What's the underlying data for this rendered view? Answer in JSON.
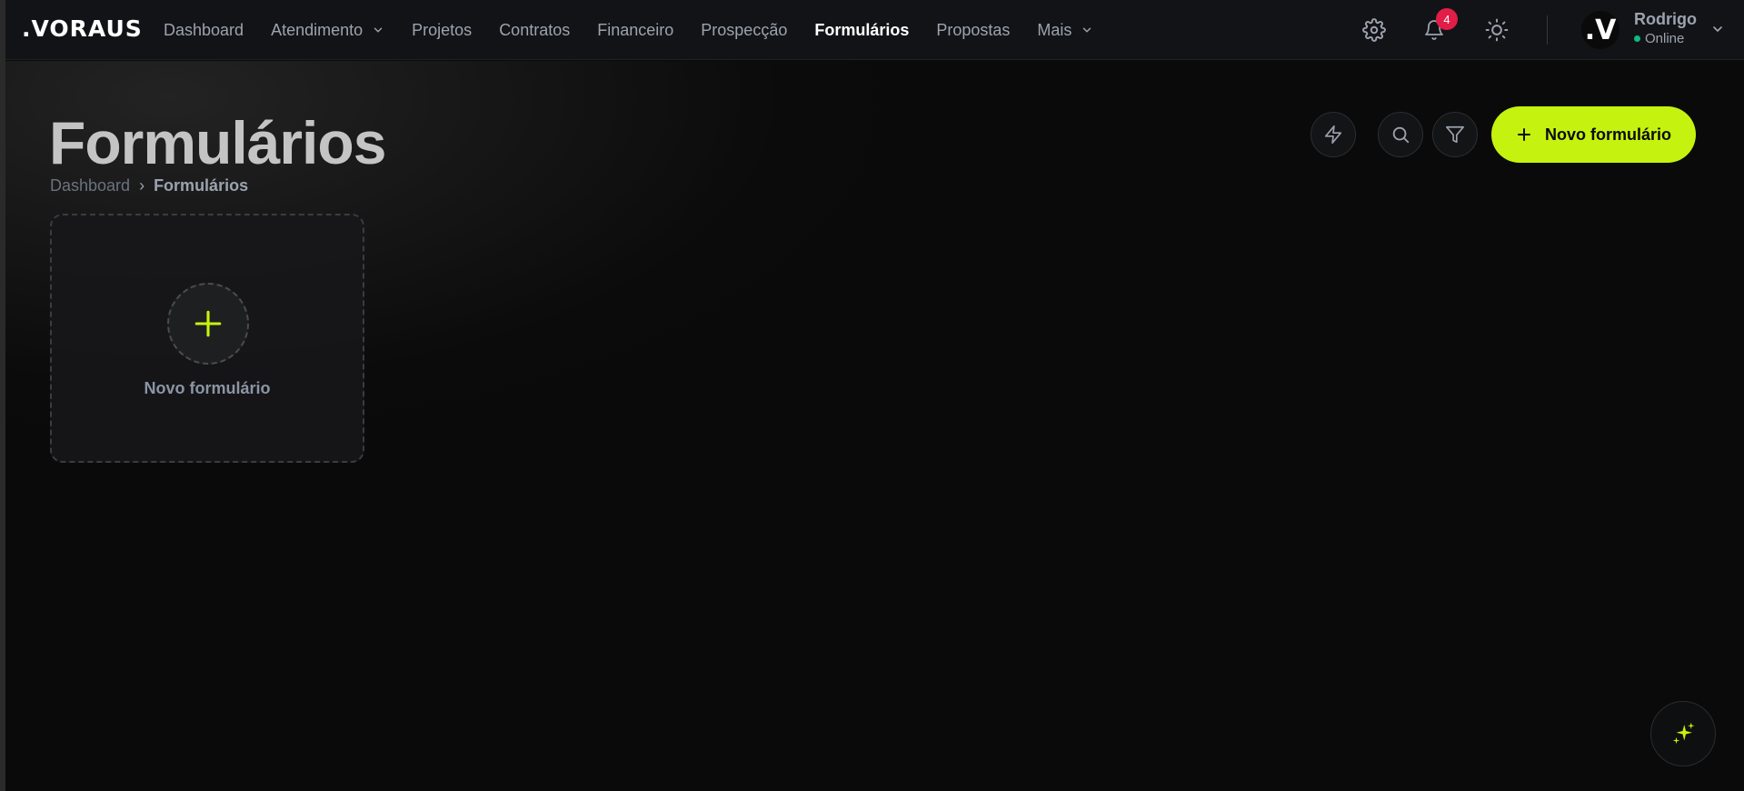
{
  "app": {
    "logo_text": ".VORAUS"
  },
  "nav": {
    "items": [
      {
        "label": "Dashboard",
        "active": false,
        "has_dropdown": false
      },
      {
        "label": "Atendimento",
        "active": false,
        "has_dropdown": true
      },
      {
        "label": "Projetos",
        "active": false,
        "has_dropdown": false
      },
      {
        "label": "Contratos",
        "active": false,
        "has_dropdown": false
      },
      {
        "label": "Financeiro",
        "active": false,
        "has_dropdown": false
      },
      {
        "label": "Prospecção",
        "active": false,
        "has_dropdown": false
      },
      {
        "label": "Formulários",
        "active": true,
        "has_dropdown": false
      },
      {
        "label": "Propostas",
        "active": false,
        "has_dropdown": false
      },
      {
        "label": "Mais",
        "active": false,
        "has_dropdown": true
      }
    ]
  },
  "header_actions": {
    "settings_icon": "gear-icon",
    "notifications_icon": "bell-icon",
    "notifications_count": "4",
    "theme_icon": "sun-icon"
  },
  "user": {
    "avatar_text": ".V",
    "name": "Rodrigo",
    "status": "Online"
  },
  "page": {
    "title": "Formulários",
    "breadcrumb": [
      {
        "label": "Dashboard"
      },
      {
        "label": "Formulários"
      }
    ],
    "breadcrumb_separator": "›",
    "actions": {
      "quick_icon": "lightning-icon",
      "search_icon": "search-icon",
      "filter_icon": "filter-icon",
      "primary_label": "Novo formulário"
    }
  },
  "new_card": {
    "label": "Novo formulário"
  },
  "fab": {
    "icon": "sparkles-icon"
  },
  "colors": {
    "accent": "#c6f20f",
    "badge": "#e11d48",
    "online": "#10b981",
    "topbar_bg": "#121316",
    "page_bg": "#0a0a0a"
  }
}
